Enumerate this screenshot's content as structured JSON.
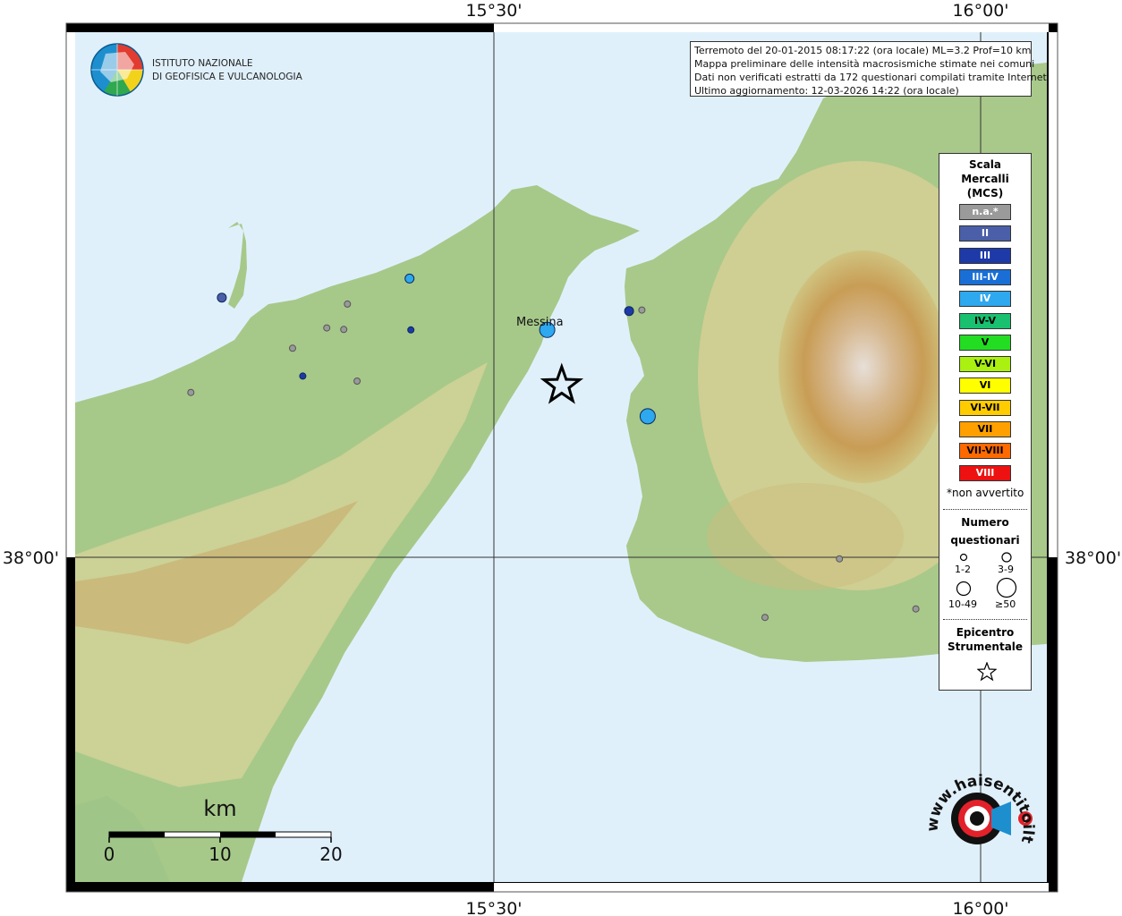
{
  "header": {
    "lines": [
      "Terremoto del 20-01-2015 08:17:22 (ora locale) ML=3.2 Prof=10 km",
      "Mappa preliminare delle intensità macrosismiche stimate nei comuni",
      "Dati non verificati estratti da 172 questionari compilati tramite Internet.",
      "Ultimo aggiornamento: 12-03-2026 14:22 (ora locale)"
    ]
  },
  "logo": {
    "line1": "ISTITUTO NAZIONALE",
    "line2": "DI GEOFISICA E VULCANOLOGIA"
  },
  "coords": {
    "lon1": "15°30'",
    "lon2": "16°00'",
    "lat1": "38°00'"
  },
  "city": "Messina",
  "legend": {
    "title": [
      "Scala",
      "Mercalli",
      "(MCS)"
    ],
    "scale": [
      {
        "label": "n.a.*",
        "color": "#9a9a9a",
        "text_color": "#ffffff"
      },
      {
        "label": "II",
        "color": "#4a5fa8",
        "text_color": "#ffffff"
      },
      {
        "label": "III",
        "color": "#1e3aa8",
        "text_color": "#ffffff"
      },
      {
        "label": "III-IV",
        "color": "#1a6fd6",
        "text_color": "#ffffff"
      },
      {
        "label": "IV",
        "color": "#2ea8ee",
        "text_color": "#ffffff"
      },
      {
        "label": "IV-V",
        "color": "#18c070",
        "text_color": "#000000"
      },
      {
        "label": "V",
        "color": "#22dd22",
        "text_color": "#000000"
      },
      {
        "label": "V-VI",
        "color": "#aaf010",
        "text_color": "#000000"
      },
      {
        "label": "VI",
        "color": "#ffff00",
        "text_color": "#000000"
      },
      {
        "label": "VI-VII",
        "color": "#ffcc00",
        "text_color": "#000000"
      },
      {
        "label": "VII",
        "color": "#ffa000",
        "text_color": "#000000"
      },
      {
        "label": "VII-VIII",
        "color": "#ff6a00",
        "text_color": "#000000"
      },
      {
        "label": "VIII",
        "color": "#ee1111",
        "text_color": "#ffffff"
      }
    ],
    "note": "*non avvertito",
    "count_title": [
      "Numero",
      "questionari"
    ],
    "count_sizes": [
      "1-2",
      "3-9",
      "10-49",
      "≥50"
    ],
    "epicenter_title": [
      "Epicentro",
      "Strumentale"
    ]
  },
  "scalebar": {
    "unit": "km",
    "ticks": [
      "0",
      "10",
      "20"
    ]
  },
  "brand": {
    "text": "www.haisentitoilterremoto.it"
  },
  "points": [
    {
      "lon": 15.2205,
      "lat": 38.2615,
      "intensity": "II",
      "size": "3-9"
    },
    {
      "lon": 15.4133,
      "lat": 38.2807,
      "intensity": "IV",
      "size": "3-9"
    },
    {
      "lon": 15.4147,
      "lat": 38.229,
      "intensity": "III",
      "size": "1-2"
    },
    {
      "lon": 15.3495,
      "lat": 38.255,
      "intensity": "n.a.*",
      "size": "1-2"
    },
    {
      "lon": 15.3283,
      "lat": 38.231,
      "intensity": "n.a.*",
      "size": "1-2"
    },
    {
      "lon": 15.3458,
      "lat": 38.2295,
      "intensity": "n.a.*",
      "size": "1-2"
    },
    {
      "lon": 15.2932,
      "lat": 38.2105,
      "intensity": "n.a.*",
      "size": "1-2"
    },
    {
      "lon": 15.3037,
      "lat": 38.1825,
      "intensity": "III",
      "size": "1-2"
    },
    {
      "lon": 15.3595,
      "lat": 38.1775,
      "intensity": "n.a.*",
      "size": "1-2"
    },
    {
      "lon": 15.1887,
      "lat": 38.166,
      "intensity": "n.a.*",
      "size": "1-2"
    },
    {
      "lon": 15.5548,
      "lat": 38.229,
      "intensity": "IV",
      "size": "10-49"
    },
    {
      "lon": 15.6389,
      "lat": 38.248,
      "intensity": "III",
      "size": "3-9"
    },
    {
      "lon": 15.652,
      "lat": 38.249,
      "intensity": "n.a.*",
      "size": "1-2"
    },
    {
      "lon": 15.658,
      "lat": 38.142,
      "intensity": "IV",
      "size": "10-49"
    },
    {
      "lon": 15.855,
      "lat": 37.9985,
      "intensity": "n.a.*",
      "size": "1-2"
    },
    {
      "lon": 15.7785,
      "lat": 37.9395,
      "intensity": "n.a.*",
      "size": "1-2"
    },
    {
      "lon": 15.9335,
      "lat": 37.948,
      "intensity": "n.a.*",
      "size": "1-2"
    }
  ],
  "epicenter": {
    "lon": 15.5697,
    "lat": 38.173
  },
  "map_extent": {
    "lon": [
      15.0,
      16.0
    ],
    "lat": [
      37.8,
      38.35
    ]
  }
}
